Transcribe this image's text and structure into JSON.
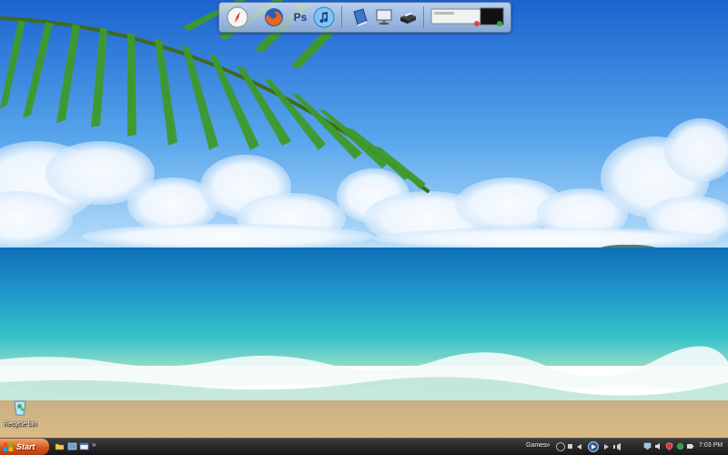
{
  "desktop": {
    "icons": [
      {
        "label": "Recycle bin",
        "icon": "recycle-bin-icon"
      }
    ]
  },
  "dock": {
    "items": [
      {
        "icon": "safari-compass-icon"
      },
      {
        "icon": "firefox-icon"
      },
      {
        "icon": "photoshop-icon",
        "text": "Ps"
      },
      {
        "icon": "itunes-icon"
      },
      {
        "icon": "blue-book-icon"
      },
      {
        "icon": "computer-monitor-icon"
      },
      {
        "icon": "printer-icon"
      },
      {
        "icon": "media-player-widget-icon"
      }
    ]
  },
  "taskbar": {
    "start_label": "Start",
    "quicklaunch_chevron": "»",
    "toolbar_label": "Games",
    "toolbar_chevron": "»",
    "clock": "7:03 PM"
  },
  "colors": {
    "sky_top": "#1f6fd6",
    "sea": "#1aa6c9",
    "sand": "#d9b77e",
    "taskbar": "#1e1e1e",
    "start_orange": "#d2511b"
  }
}
